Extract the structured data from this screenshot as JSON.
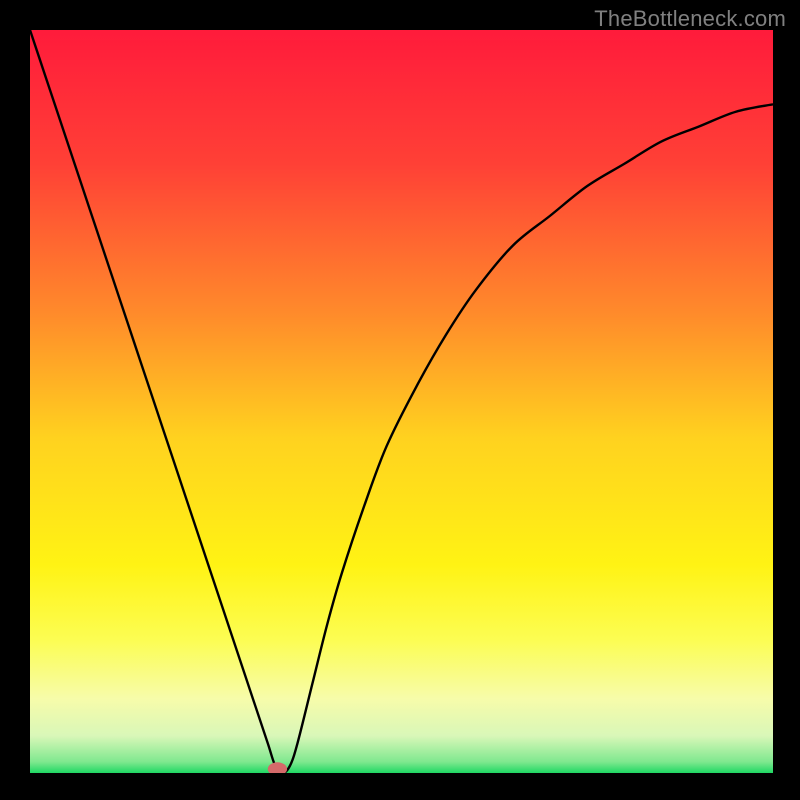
{
  "watermark": "TheBottleneck.com",
  "colors": {
    "background": "#000000",
    "watermark": "#808080",
    "curve": "#000000",
    "marker_fill": "#d46a6a",
    "gradient_stops": [
      {
        "offset": 0.0,
        "color": "#ff1b3b"
      },
      {
        "offset": 0.18,
        "color": "#ff4036"
      },
      {
        "offset": 0.38,
        "color": "#ff8a2b"
      },
      {
        "offset": 0.55,
        "color": "#ffd21f"
      },
      {
        "offset": 0.72,
        "color": "#fff314"
      },
      {
        "offset": 0.82,
        "color": "#fcfd52"
      },
      {
        "offset": 0.9,
        "color": "#f7fcaa"
      },
      {
        "offset": 0.95,
        "color": "#d9f7b8"
      },
      {
        "offset": 0.985,
        "color": "#7fe88f"
      },
      {
        "offset": 1.0,
        "color": "#1fd863"
      }
    ]
  },
  "chart_data": {
    "type": "line",
    "title": "",
    "xlabel": "",
    "ylabel": "",
    "xlim": [
      0,
      100
    ],
    "ylim": [
      0,
      100
    ],
    "series": [
      {
        "name": "bottleneck-curve",
        "x": [
          0,
          2,
          4,
          6,
          8,
          10,
          12,
          14,
          16,
          18,
          20,
          22,
          24,
          26,
          28,
          30,
          32,
          33,
          34,
          35,
          36,
          38,
          40,
          42,
          45,
          48,
          52,
          56,
          60,
          65,
          70,
          75,
          80,
          85,
          90,
          95,
          100
        ],
        "values": [
          100,
          94,
          88,
          82,
          76,
          70,
          64,
          58,
          52,
          46,
          40,
          34,
          28,
          22,
          16,
          10,
          4,
          1,
          0,
          1,
          4,
          12,
          20,
          27,
          36,
          44,
          52,
          59,
          65,
          71,
          75,
          79,
          82,
          85,
          87,
          89,
          90
        ]
      }
    ],
    "marker": {
      "x": 33.3,
      "y": 0,
      "rx": 1.3,
      "ry": 0.9
    },
    "legend": null,
    "grid": false
  }
}
